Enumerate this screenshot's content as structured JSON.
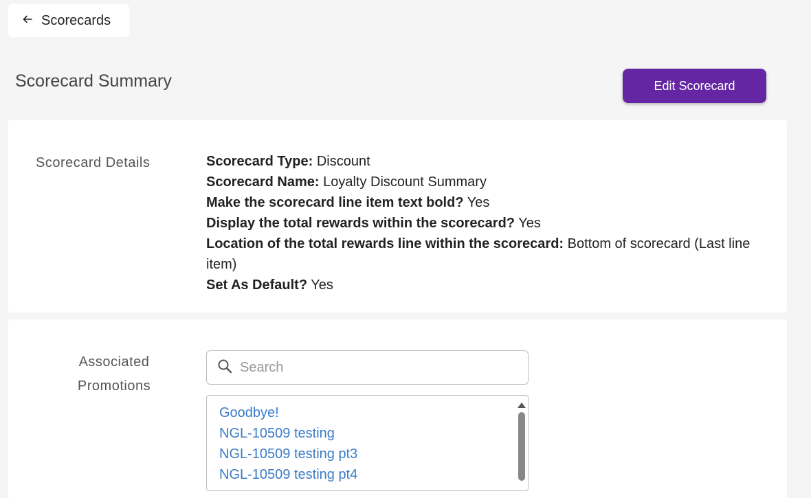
{
  "nav": {
    "back_label": "Scorecards"
  },
  "header": {
    "title": "Scorecard Summary",
    "edit_label": "Edit Scorecard"
  },
  "details": {
    "section_label": "Scorecard Details",
    "rows": [
      {
        "key": "Scorecard Type:",
        "value": "Discount"
      },
      {
        "key": "Scorecard Name:",
        "value": "Loyalty Discount Summary"
      },
      {
        "key": "Make the scorecard line item text bold?",
        "value": "Yes"
      },
      {
        "key": "Display the total rewards within the scorecard?",
        "value": "Yes"
      },
      {
        "key": "Location of the total rewards line within the scorecard:",
        "value": "Bottom of scorecard (Last line item)"
      },
      {
        "key": "Set As Default?",
        "value": "Yes"
      }
    ]
  },
  "promotions": {
    "section_label_line1": "Associated",
    "section_label_line2": "Promotions",
    "search": {
      "placeholder": "Search",
      "value": ""
    },
    "items": [
      "Goodbye!",
      "NGL-10509 testing",
      "NGL-10509 testing pt3",
      "NGL-10509 testing pt4"
    ]
  },
  "colors": {
    "primary_button": "#6426a3",
    "link": "#3a7bc8",
    "background": "#f5f5f5"
  },
  "icons": {
    "back": "arrow-left-icon",
    "search": "search-icon",
    "scroll_up": "caret-up-icon"
  }
}
